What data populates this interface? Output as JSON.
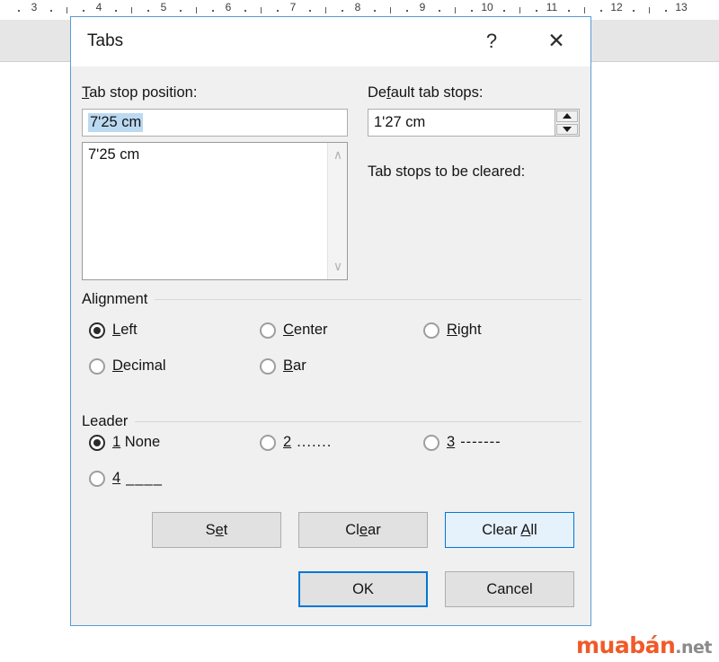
{
  "ruler": {
    "numbers": [
      3,
      4,
      5,
      6,
      7,
      8,
      9,
      10,
      11,
      12,
      13
    ]
  },
  "dialog": {
    "title": "Tabs",
    "help_glyph": "?",
    "close_glyph": "✕",
    "tab_stop_position": {
      "label": "Tab stop position:",
      "mnemonic": "T",
      "label_rest": "ab stop position:",
      "value": "7'25 cm"
    },
    "tab_stop_list": {
      "items": [
        "7'25 cm"
      ],
      "scroll_up": "∧",
      "scroll_down": "∨"
    },
    "default_tab_stops": {
      "label_pre": "De",
      "mnemonic": "f",
      "label_rest": "ault tab stops:",
      "value": "1'27 cm"
    },
    "tab_stops_cleared_label": "Tab stops to be cleared:",
    "alignment": {
      "group_title": "Alignment",
      "options": [
        {
          "mnemonic": "L",
          "rest": "eft",
          "checked": true
        },
        {
          "mnemonic": "C",
          "rest": "enter",
          "checked": false
        },
        {
          "mnemonic": "R",
          "rest": "ight",
          "checked": false
        },
        {
          "mnemonic": "D",
          "rest": "ecimal",
          "checked": false
        },
        {
          "mnemonic": "B",
          "rest": "ar",
          "checked": false
        }
      ]
    },
    "leader": {
      "group_title": "Leader",
      "options": [
        {
          "mnemonic": "1",
          "rest": " None",
          "sample": "",
          "checked": true
        },
        {
          "mnemonic": "2",
          "rest": "",
          "sample": ".......",
          "checked": false
        },
        {
          "mnemonic": "3",
          "rest": "",
          "sample": "-------",
          "checked": false
        },
        {
          "mnemonic": "4",
          "rest": "",
          "sample": "____",
          "checked": false
        }
      ]
    },
    "buttons": {
      "set": {
        "pre": "S",
        "mnemonic": "e",
        "rest": "t"
      },
      "clear": {
        "pre": "Cl",
        "mnemonic": "e",
        "rest": "ar"
      },
      "clear_all": {
        "pre": "Clear ",
        "mnemonic": "A",
        "rest": "ll"
      },
      "ok": "OK",
      "cancel": "Cancel"
    }
  },
  "watermark": {
    "main": "muabán",
    "tld": ".net"
  },
  "colors": {
    "dialog_border": "#5b9bd5",
    "dialog_bg": "#f0f0f0",
    "selection_blue": "#bcd9f2",
    "accent_blue": "#0078d7",
    "hover_bg": "#e5f1fb",
    "watermark_orange": "#f05a28"
  }
}
